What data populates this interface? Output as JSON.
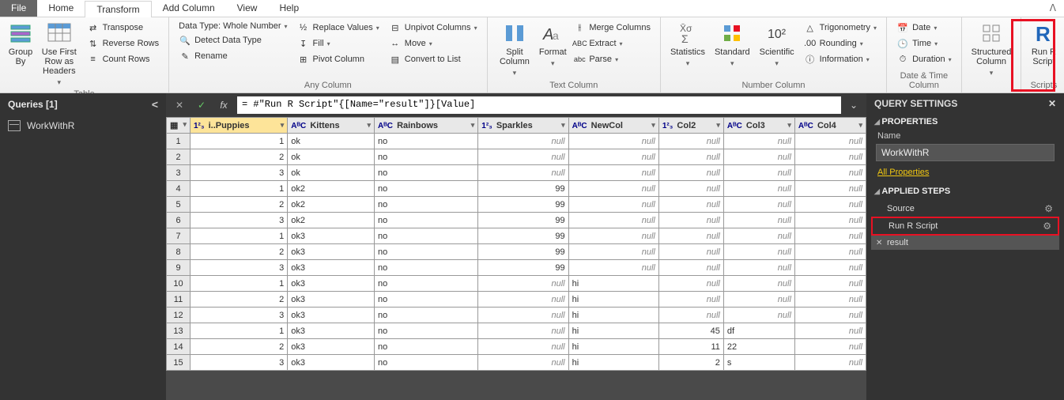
{
  "menus": {
    "file": "File",
    "home": "Home",
    "transform": "Transform",
    "addcol": "Add Column",
    "view": "View",
    "help": "Help"
  },
  "ribbon": {
    "table": {
      "group_by": "Group\nBy",
      "first_row": "Use First Row\nas Headers",
      "transpose": "Transpose",
      "reverse": "Reverse Rows",
      "count": "Count Rows",
      "label": "Table"
    },
    "anycol": {
      "datatype": "Data Type: Whole Number",
      "detect": "Detect Data Type",
      "rename": "Rename",
      "replace": "Replace Values",
      "fill": "Fill",
      "pivot": "Pivot Column",
      "unpivot": "Unpivot Columns",
      "move": "Move",
      "tolist": "Convert to List",
      "label": "Any Column"
    },
    "textcol": {
      "split": "Split\nColumn",
      "format": "Format",
      "merge": "Merge Columns",
      "extract": "Extract",
      "parse": "Parse",
      "label": "Text Column"
    },
    "numcol": {
      "stats": "Statistics",
      "standard": "Standard",
      "scientific": "Scientific",
      "trig": "Trigonometry",
      "rounding": "Rounding",
      "info": "Information",
      "label": "Number Column"
    },
    "dtcol": {
      "date": "Date",
      "time": "Time",
      "duration": "Duration",
      "label": "Date & Time Column"
    },
    "struct": {
      "structured": "Structured\nColumn"
    },
    "scripts": {
      "runr": "Run R\nScript",
      "label": "Scripts"
    }
  },
  "queries": {
    "title": "Queries [1]",
    "item": "WorkWithR"
  },
  "formula": "= #\"Run R Script\"{[Name=\"result\"]}[Value]",
  "grid": {
    "cols": [
      "i..Puppies",
      "Kittens",
      "Rainbows",
      "Sparkles",
      "NewCol",
      "Col2",
      "Col3",
      "Col4"
    ],
    "dtypes": [
      "1²₃",
      "AᴮC",
      "AᴮC",
      "1²₃",
      "AᴮC",
      "1²₃",
      "AᴮC",
      "AᴮC"
    ],
    "rows": [
      {
        "n": 1,
        "c": [
          1,
          "ok",
          "no",
          null,
          null,
          null,
          null,
          null
        ]
      },
      {
        "n": 2,
        "c": [
          2,
          "ok",
          "no",
          null,
          null,
          null,
          null,
          null
        ]
      },
      {
        "n": 3,
        "c": [
          3,
          "ok",
          "no",
          null,
          null,
          null,
          null,
          null
        ]
      },
      {
        "n": 4,
        "c": [
          1,
          "ok2",
          "no",
          99,
          null,
          null,
          null,
          null
        ]
      },
      {
        "n": 5,
        "c": [
          2,
          "ok2",
          "no",
          99,
          null,
          null,
          null,
          null
        ]
      },
      {
        "n": 6,
        "c": [
          3,
          "ok2",
          "no",
          99,
          null,
          null,
          null,
          null
        ]
      },
      {
        "n": 7,
        "c": [
          1,
          "ok3",
          "no",
          99,
          null,
          null,
          null,
          null
        ]
      },
      {
        "n": 8,
        "c": [
          2,
          "ok3",
          "no",
          99,
          null,
          null,
          null,
          null
        ]
      },
      {
        "n": 9,
        "c": [
          3,
          "ok3",
          "no",
          99,
          null,
          null,
          null,
          null
        ]
      },
      {
        "n": 10,
        "c": [
          1,
          "ok3",
          "no",
          null,
          "hi",
          null,
          null,
          null
        ]
      },
      {
        "n": 11,
        "c": [
          2,
          "ok3",
          "no",
          null,
          "hi",
          null,
          null,
          null
        ]
      },
      {
        "n": 12,
        "c": [
          3,
          "ok3",
          "no",
          null,
          "hi",
          null,
          null,
          null
        ]
      },
      {
        "n": 13,
        "c": [
          1,
          "ok3",
          "no",
          null,
          "hi",
          45,
          "df",
          null
        ]
      },
      {
        "n": 14,
        "c": [
          2,
          "ok3",
          "no",
          null,
          "hi",
          11,
          "22",
          null
        ]
      },
      {
        "n": 15,
        "c": [
          3,
          "ok3",
          "no",
          null,
          "hi",
          2,
          "s",
          null
        ]
      }
    ]
  },
  "settings": {
    "title": "QUERY SETTINGS",
    "properties": "PROPERTIES",
    "name_label": "Name",
    "name_value": "WorkWithR",
    "all_props": "All Properties",
    "applied": "APPLIED STEPS",
    "steps": [
      {
        "label": "Source",
        "gear": true
      },
      {
        "label": "Run R Script",
        "gear": true,
        "highlight": true
      },
      {
        "label": "result",
        "x": true,
        "selected": true
      }
    ]
  }
}
